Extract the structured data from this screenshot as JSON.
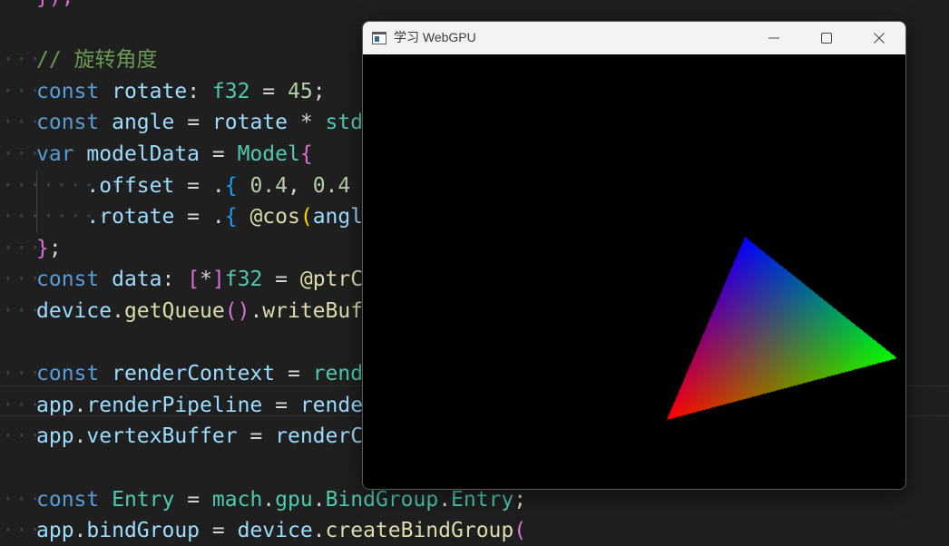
{
  "editor": {
    "lines": [
      {
        "dots": "",
        "tokens": [
          {
            "t": "});",
            "c": "tk-b1"
          }
        ]
      },
      {
        "dots": "",
        "tokens": []
      },
      {
        "dots": "···",
        "tokens": [
          {
            "t": "// 旋转角度",
            "c": "tk-cmt"
          }
        ]
      },
      {
        "dots": "···",
        "tokens": [
          {
            "t": "const",
            "c": "tk-kw"
          },
          {
            "t": " "
          },
          {
            "t": "rotate",
            "c": "tk-var"
          },
          {
            "t": ": "
          },
          {
            "t": "f32",
            "c": "tk-type"
          },
          {
            "t": " = "
          },
          {
            "t": "45",
            "c": "tk-num"
          },
          {
            "t": ";"
          }
        ]
      },
      {
        "dots": "···",
        "tokens": [
          {
            "t": "const",
            "c": "tk-kw"
          },
          {
            "t": " "
          },
          {
            "t": "angle",
            "c": "tk-var"
          },
          {
            "t": " = "
          },
          {
            "t": "rotate",
            "c": "tk-var"
          },
          {
            "t": " * "
          },
          {
            "t": "std",
            "c": "tk-type"
          }
        ]
      },
      {
        "dots": "···",
        "tokens": [
          {
            "t": "var",
            "c": "tk-kw"
          },
          {
            "t": " "
          },
          {
            "t": "modelData",
            "c": "tk-var"
          },
          {
            "t": " = "
          },
          {
            "t": "Model",
            "c": "tk-type"
          },
          {
            "t": "{",
            "c": "tk-b1"
          }
        ]
      },
      {
        "dots": "··········",
        "tokens": [
          {
            "t": "    "
          },
          {
            "t": ".offset",
            "c": "tk-var"
          },
          {
            "t": " = ."
          },
          {
            "t": "{",
            "c": "tk-b2"
          },
          {
            "t": " "
          },
          {
            "t": "0.4",
            "c": "tk-num"
          },
          {
            "t": ", "
          },
          {
            "t": "0.4",
            "c": "tk-num"
          }
        ]
      },
      {
        "dots": "··········",
        "tokens": [
          {
            "t": "    "
          },
          {
            "t": ".rotate",
            "c": "tk-var"
          },
          {
            "t": " = ."
          },
          {
            "t": "{",
            "c": "tk-b2"
          },
          {
            "t": " "
          },
          {
            "t": "@cos",
            "c": "tk-fn"
          },
          {
            "t": "(",
            "c": "tk-b3"
          },
          {
            "t": "angl",
            "c": "tk-var"
          }
        ]
      },
      {
        "dots": "···",
        "tokens": [
          {
            "t": "}",
            "c": "tk-b1"
          },
          {
            "t": ";"
          }
        ]
      },
      {
        "dots": "···",
        "tokens": [
          {
            "t": "const",
            "c": "tk-kw"
          },
          {
            "t": " "
          },
          {
            "t": "data",
            "c": "tk-var"
          },
          {
            "t": ": "
          },
          {
            "t": "[",
            "c": "tk-b1"
          },
          {
            "t": "*"
          },
          {
            "t": "]",
            "c": "tk-b1"
          },
          {
            "t": "f32",
            "c": "tk-type"
          },
          {
            "t": " = "
          },
          {
            "t": "@ptrC",
            "c": "tk-fn"
          }
        ]
      },
      {
        "dots": "···",
        "tokens": [
          {
            "t": "device",
            "c": "tk-var"
          },
          {
            "t": "."
          },
          {
            "t": "getQueue",
            "c": "tk-fn"
          },
          {
            "t": "()",
            "c": "tk-b1"
          },
          {
            "t": "."
          },
          {
            "t": "writeBuf",
            "c": "tk-fn"
          }
        ]
      },
      {
        "dots": "",
        "tokens": []
      },
      {
        "dots": "···",
        "tokens": [
          {
            "t": "const",
            "c": "tk-kw"
          },
          {
            "t": " "
          },
          {
            "t": "renderContext",
            "c": "tk-var"
          },
          {
            "t": " = "
          },
          {
            "t": "rend",
            "c": "tk-type"
          }
        ]
      },
      {
        "dots": "···",
        "tokens": [
          {
            "t": "app",
            "c": "tk-var"
          },
          {
            "t": "."
          },
          {
            "t": "renderPipeline",
            "c": "tk-var"
          },
          {
            "t": " = "
          },
          {
            "t": "rende",
            "c": "tk-var"
          }
        ]
      },
      {
        "dots": "···",
        "tokens": [
          {
            "t": "app",
            "c": "tk-var"
          },
          {
            "t": "."
          },
          {
            "t": "vertexBuffer",
            "c": "tk-var"
          },
          {
            "t": " = "
          },
          {
            "t": "renderC",
            "c": "tk-var"
          }
        ]
      },
      {
        "dots": "",
        "tokens": []
      },
      {
        "dots": "···",
        "tokens": [
          {
            "t": "const",
            "c": "tk-kw"
          },
          {
            "t": " "
          },
          {
            "t": "Entry",
            "c": "tk-type"
          },
          {
            "t": " = "
          },
          {
            "t": "mach",
            "c": "tk-type"
          },
          {
            "t": "."
          },
          {
            "t": "gpu",
            "c": "tk-type"
          },
          {
            "t": "."
          },
          {
            "t": "BindGroup",
            "c": "tk-type"
          },
          {
            "t": "."
          },
          {
            "t": "Entry",
            "c": "tk-type"
          },
          {
            "t": ";"
          }
        ]
      },
      {
        "dots": "···",
        "tokens": [
          {
            "t": "app",
            "c": "tk-var"
          },
          {
            "t": "."
          },
          {
            "t": "bindGroup",
            "c": "tk-var"
          },
          {
            "t": " = "
          },
          {
            "t": "device",
            "c": "tk-var"
          },
          {
            "t": "."
          },
          {
            "t": "createBindGroup",
            "c": "tk-fn"
          },
          {
            "t": "(",
            "c": "tk-b1"
          }
        ]
      }
    ]
  },
  "window": {
    "title": "学习 WebGPU",
    "icon": "app-window-icon",
    "buttons": {
      "minimize": "minimize-icon",
      "maximize": "maximize-icon",
      "close": "close-icon"
    }
  },
  "canvas": {
    "background": "#000000",
    "triangle": {
      "vertex_colors": [
        "#0000ff",
        "#00ff00",
        "#ff0000"
      ]
    }
  }
}
